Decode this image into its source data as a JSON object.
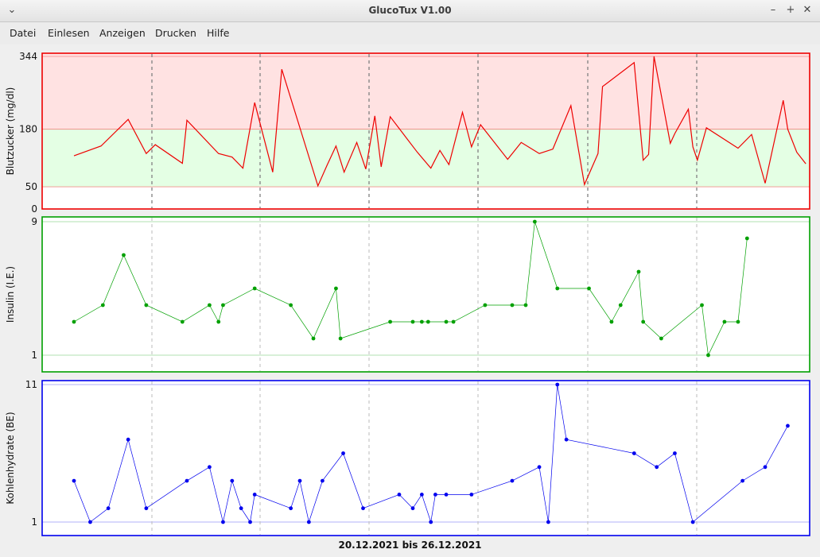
{
  "window": {
    "title": "GlucoTux V1.00",
    "buttons": [
      "⌄",
      "–",
      "+",
      "✕"
    ]
  },
  "menu": [
    "Datei",
    "Einlesen",
    "Anzeigen",
    "Drucken",
    "Hilfe"
  ],
  "colors": {
    "glucose": "#ee0000",
    "glucose_high_zone": "#ffe2e2",
    "glucose_ok_zone": "#e4ffe4",
    "insulin": "#00a000",
    "carbs": "#0000ee"
  },
  "date_range": "20.12.2021 bis 26.12.2021",
  "chart_data": [
    {
      "type": "line",
      "ylabel": "Blutzucker (mg/dl)",
      "yticks": [
        0,
        50,
        180,
        344
      ],
      "ylim": [
        0,
        350
      ],
      "zones": [
        {
          "from": 180,
          "to": 350,
          "color": "high"
        },
        {
          "from": 50,
          "to": 180,
          "color": "ok"
        }
      ],
      "day_separators": 6,
      "series": [
        {
          "values": [
            [
              0.0,
              120
            ],
            [
              0.3,
              142
            ],
            [
              0.6,
              202
            ],
            [
              0.8,
              125
            ],
            [
              0.9,
              145
            ],
            [
              1.2,
              103
            ],
            [
              1.25,
              200
            ],
            [
              1.6,
              125
            ],
            [
              1.75,
              117
            ],
            [
              1.87,
              92
            ],
            [
              2.0,
              240
            ],
            [
              2.2,
              83
            ],
            [
              2.3,
              315
            ],
            [
              2.7,
              52
            ],
            [
              2.8,
              98
            ],
            [
              2.9,
              142
            ],
            [
              2.99,
              83
            ],
            [
              3.13,
              150
            ],
            [
              3.23,
              90
            ],
            [
              3.33,
              210
            ],
            [
              3.4,
              95
            ],
            [
              3.5,
              208
            ],
            [
              3.8,
              128
            ],
            [
              3.95,
              92
            ],
            [
              4.05,
              132
            ],
            [
              4.15,
              100
            ],
            [
              4.3,
              218
            ],
            [
              4.4,
              140
            ],
            [
              4.5,
              190
            ],
            [
              4.8,
              112
            ],
            [
              4.95,
              150
            ],
            [
              5.15,
              125
            ],
            [
              5.3,
              135
            ],
            [
              5.5,
              233
            ],
            [
              5.65,
              55
            ],
            [
              5.8,
              125
            ],
            [
              5.85,
              276
            ],
            [
              6.2,
              330
            ],
            [
              6.3,
              110
            ],
            [
              6.36,
              123
            ],
            [
              6.42,
              344
            ],
            [
              6.6,
              148
            ],
            [
              6.65,
              170
            ],
            [
              6.8,
              225
            ],
            [
              6.85,
              140
            ],
            [
              6.9,
              110
            ],
            [
              7.0,
              183
            ],
            [
              7.35,
              137
            ],
            [
              7.5,
              168
            ],
            [
              7.65,
              58
            ],
            [
              7.85,
              245
            ],
            [
              7.9,
              180
            ],
            [
              8.0,
              128
            ],
            [
              8.1,
              102
            ]
          ]
        }
      ]
    },
    {
      "type": "line",
      "ylabel": "Insulin (I.E.)",
      "yticks": [
        1,
        9
      ],
      "ylim": [
        1,
        9
      ],
      "series": [
        {
          "values": [
            [
              0.0,
              3
            ],
            [
              0.32,
              4
            ],
            [
              0.55,
              7
            ],
            [
              0.8,
              4
            ],
            [
              1.2,
              3
            ],
            [
              1.5,
              4
            ],
            [
              1.6,
              3
            ],
            [
              1.65,
              4
            ],
            [
              2.0,
              5
            ],
            [
              2.4,
              4
            ],
            [
              2.65,
              2
            ],
            [
              2.9,
              5
            ],
            [
              2.95,
              2
            ],
            [
              3.5,
              3
            ],
            [
              3.75,
              3
            ],
            [
              3.85,
              3
            ],
            [
              3.92,
              3
            ],
            [
              4.12,
              3
            ],
            [
              4.2,
              3
            ],
            [
              4.55,
              4
            ],
            [
              4.85,
              4
            ],
            [
              5.0,
              4
            ],
            [
              5.1,
              9
            ],
            [
              5.35,
              5
            ],
            [
              5.7,
              5
            ],
            [
              5.95,
              3
            ],
            [
              6.05,
              4
            ],
            [
              6.25,
              6
            ],
            [
              6.3,
              3
            ],
            [
              6.5,
              2
            ],
            [
              6.95,
              4
            ],
            [
              7.02,
              1
            ],
            [
              7.2,
              3
            ],
            [
              7.35,
              3
            ],
            [
              7.45,
              8
            ]
          ]
        }
      ]
    },
    {
      "type": "line",
      "ylabel": "Kohlenhydrate (BE)",
      "yticks": [
        1,
        11
      ],
      "ylim": [
        1,
        11
      ],
      "series": [
        {
          "values": [
            [
              0.0,
              4
            ],
            [
              0.18,
              1
            ],
            [
              0.38,
              2
            ],
            [
              0.6,
              7
            ],
            [
              0.8,
              2
            ],
            [
              1.25,
              4
            ],
            [
              1.5,
              5
            ],
            [
              1.65,
              1
            ],
            [
              1.75,
              4
            ],
            [
              1.85,
              2
            ],
            [
              1.95,
              1
            ],
            [
              2.0,
              3
            ],
            [
              2.4,
              2
            ],
            [
              2.5,
              4
            ],
            [
              2.6,
              1
            ],
            [
              2.75,
              4
            ],
            [
              2.98,
              6
            ],
            [
              3.2,
              2
            ],
            [
              3.6,
              3
            ],
            [
              3.75,
              2
            ],
            [
              3.85,
              3
            ],
            [
              3.95,
              1
            ],
            [
              4.0,
              3
            ],
            [
              4.12,
              3
            ],
            [
              4.4,
              3
            ],
            [
              4.85,
              4
            ],
            [
              5.15,
              5
            ],
            [
              5.25,
              1
            ],
            [
              5.35,
              11
            ],
            [
              5.45,
              7
            ],
            [
              6.2,
              6
            ],
            [
              6.45,
              5
            ],
            [
              6.65,
              6
            ],
            [
              6.85,
              1
            ],
            [
              7.4,
              4
            ],
            [
              7.65,
              5
            ],
            [
              7.9,
              8
            ]
          ]
        }
      ]
    }
  ]
}
